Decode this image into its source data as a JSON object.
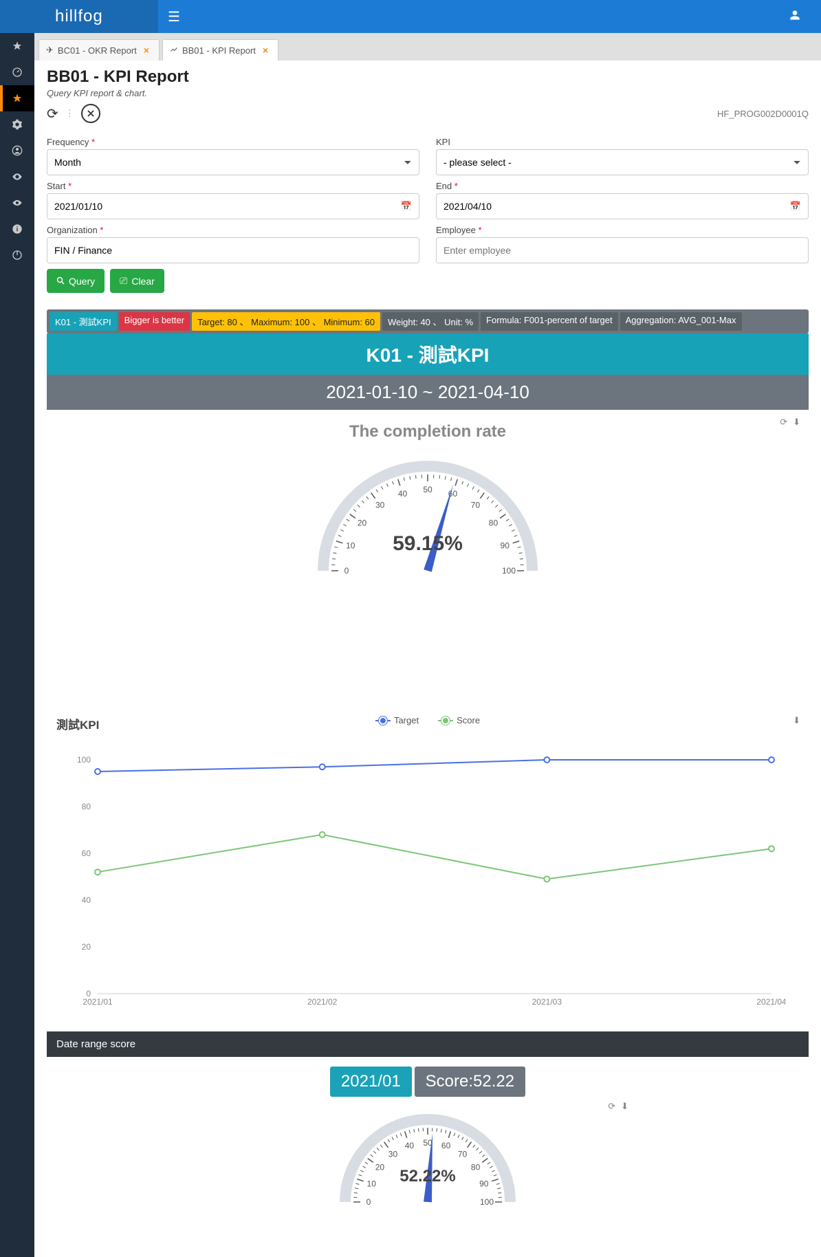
{
  "brand": "hillfog",
  "prog_id": "HF_PROG002D0001Q",
  "tabs": [
    {
      "label": "BC01 - OKR Report"
    },
    {
      "label": "BB01 - KPI Report"
    }
  ],
  "page": {
    "title": "BB01 - KPI Report",
    "subtitle": "Query KPI report & chart."
  },
  "form": {
    "frequency_label": "Frequency",
    "frequency_value": "Month",
    "kpi_label": "KPI",
    "kpi_placeholder": "- please select -",
    "start_label": "Start",
    "start_value": "2021/01/10",
    "end_label": "End",
    "end_value": "2021/04/10",
    "org_label": "Organization",
    "org_value": "FIN / Finance",
    "emp_label": "Employee",
    "emp_placeholder": "Enter employee",
    "query_btn": "Query",
    "clear_btn": "Clear"
  },
  "pills": {
    "kpi": "K01 - 測試KPI",
    "bigger": "Bigger is better",
    "target": "Target: 80 、 Maximum: 100 、 Minimum: 60",
    "weight": "Weight: 40 、 Unit: %",
    "formula": "Formula: F001-percent of target",
    "aggregation": "Aggregation: AVG_001-Max"
  },
  "kpi_header": "K01 - 測試KPI",
  "date_range": "2021-01-10 ~ 2021-04-10",
  "gauge": {
    "title": "The completion rate",
    "value": 59.15,
    "display": "59.15%"
  },
  "chart_data": {
    "title": "測試KPI",
    "type": "line",
    "categories": [
      "2021/01",
      "2021/02",
      "2021/03",
      "2021/04"
    ],
    "series": [
      {
        "name": "Target",
        "values": [
          95,
          97,
          100,
          100
        ],
        "color": "#4a6fe3"
      },
      {
        "name": "Score",
        "values": [
          52,
          68,
          49,
          62
        ],
        "color": "#7cc576"
      }
    ],
    "ylim": [
      0,
      100
    ],
    "yticks": [
      0,
      20,
      40,
      60,
      80,
      100
    ]
  },
  "section_bar": "Date range score",
  "score_tag": {
    "date": "2021/01",
    "score": "Score:52.22"
  },
  "gauge2": {
    "value": 52.22,
    "display": "52.22%"
  }
}
